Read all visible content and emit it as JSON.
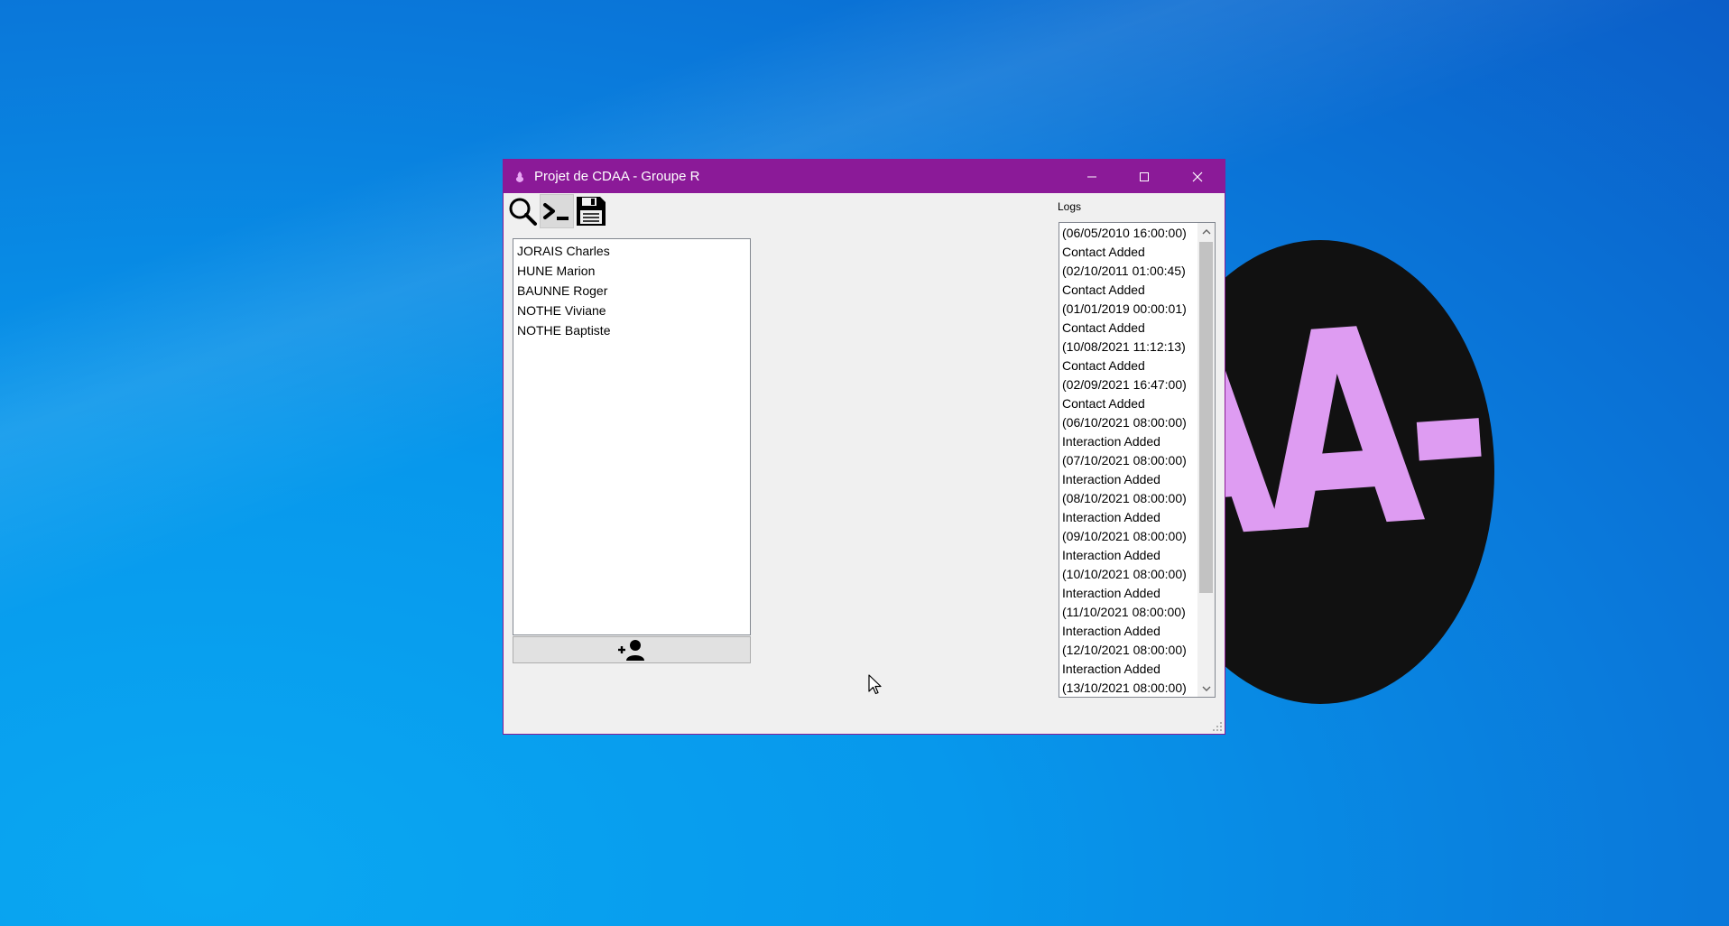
{
  "window": {
    "title": "Projet de CDAA - Groupe R",
    "accent_color": "#8b1a98"
  },
  "toolbar": {
    "items": [
      {
        "icon": "search-icon",
        "pressed": false
      },
      {
        "icon": "terminal-icon",
        "pressed": true
      },
      {
        "icon": "save-icon",
        "pressed": false
      }
    ]
  },
  "contacts": [
    "JORAIS Charles",
    "HUNE Marion",
    "BAUNNE Roger",
    "NOTHE Viviane",
    "NOTHE Baptiste"
  ],
  "add_contact_button": {
    "icon": "add-user-icon"
  },
  "logs": {
    "label": "Logs",
    "lines": [
      "(06/05/2010 16:00:00)",
      "Contact Added",
      "(02/10/2011 01:00:45)",
      "Contact Added",
      "(01/01/2019 00:00:01)",
      "Contact Added",
      "(10/08/2021 11:12:13)",
      "Contact Added",
      "(02/09/2021 16:47:00)",
      "Contact Added",
      "(06/10/2021 08:00:00)",
      "Interaction Added",
      "(07/10/2021 08:00:00)",
      "Interaction Added",
      "(08/10/2021 08:00:00)",
      "Interaction Added",
      "(09/10/2021 08:00:00)",
      "Interaction Added",
      "(10/10/2021 08:00:00)",
      "Interaction Added",
      "(11/10/2021 08:00:00)",
      "Interaction Added",
      "(12/10/2021 08:00:00)",
      "Interaction Added",
      "(13/10/2021 08:00:00)"
    ]
  },
  "wallpaper": {
    "logo_text": "AA-R",
    "logo_color": "#de9cf2",
    "background_color": "#0a8ee6"
  }
}
